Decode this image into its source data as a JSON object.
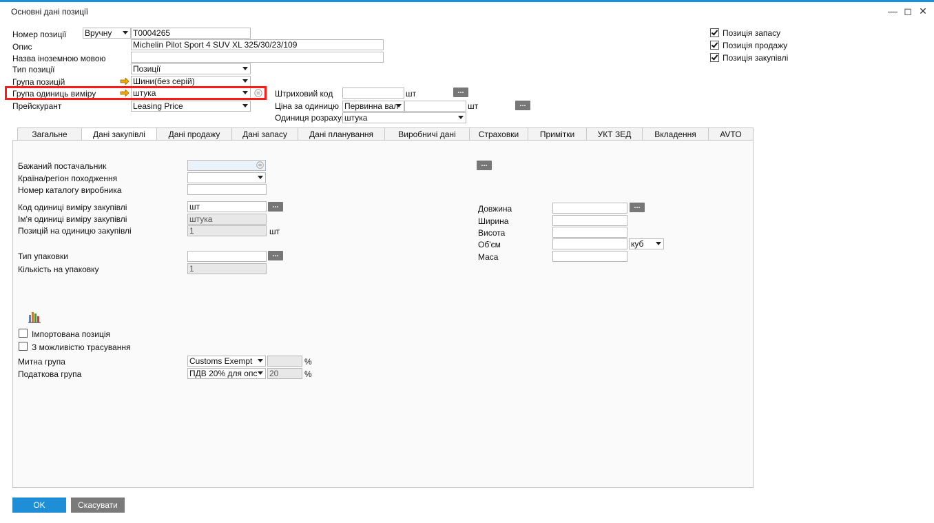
{
  "window": {
    "title": "Основні дані позиції",
    "minimize_icon": "minimize-icon",
    "maximize_icon": "maximize-icon",
    "close_icon": "close-icon"
  },
  "header": {
    "item_no_label": "Номер позиції",
    "numbering_value": "Вручну",
    "item_no_value": "T0004265",
    "description_label": "Опис",
    "description_value": "Michelin Pilot Sport 4 SUV XL 325/30/23/109",
    "foreign_name_label": "Назва іноземною мовою",
    "foreign_name_value": "",
    "item_type_label": "Тип позиції",
    "item_type_value": "Позиції",
    "item_group_label": "Група позицій",
    "item_group_value": "Шини(без серій)",
    "uom_group_label": "Група одиниць виміру",
    "uom_group_value": "штука",
    "price_list_label": "Прейскурант",
    "price_list_value": "Leasing Price",
    "barcode_label": "Штриховий код",
    "barcode_value": "",
    "barcode_unit": "шт",
    "unit_price_label": "Ціна за одиницю",
    "unit_price_currency": "Первинна вал",
    "unit_price_value": "",
    "unit_price_unit": "шт",
    "calc_unit_label": "Одиниця розрахун",
    "calc_unit_value": "штука",
    "inventory_item_label": "Позиція запасу",
    "sales_item_label": "Позиція продажу",
    "purchase_item_label": "Позиція закупівлі",
    "dots": "..."
  },
  "tabs": [
    "Загальне",
    "Дані закупівлі",
    "Дані продажу",
    "Дані запасу",
    "Дані планування",
    "Виробничі дані",
    "Страховки",
    "Примітки",
    "УКТ ЗЕД",
    "Вкладення",
    "AVTO"
  ],
  "purchasing": {
    "vendor_label": "Бажаний постачальник",
    "vendor_value": "",
    "country_label": "Країна/регіон походження",
    "country_value": "",
    "catalog_label": "Номер каталогу виробника",
    "catalog_value": "",
    "uom_code_label": "Код одиниці виміру закупівлі",
    "uom_code_value": "шт",
    "uom_name_label": "Ім'я одиниці виміру закупівлі",
    "uom_name_value": "штука",
    "items_per_unit_label": "Позицій на одиницю закупівлі",
    "items_per_unit_value": "1",
    "items_per_unit_unit": "шт",
    "pack_type_label": "Тип упаковки",
    "pack_type_value": "",
    "qty_per_pack_label": "Кількість на упаковку",
    "qty_per_pack_value": "1",
    "length_label": "Довжина",
    "width_label": "Ширина",
    "height_label": "Висота",
    "volume_label": "Об'єм",
    "volume_unit": "куб",
    "weight_label": "Маса",
    "imported_label": "Імпортована позиція",
    "traceable_label": "З можливістю трасування",
    "customs_label": "Митна група",
    "customs_value": "Customs Exempt",
    "customs_pct": "",
    "tax_label": "Податкова група",
    "tax_value": "ПДВ 20% для опс",
    "tax_pct": "20",
    "percent": "%"
  },
  "footer": {
    "ok": "OK",
    "cancel": "Скасувати"
  },
  "colors": {
    "accent": "#1e8fd6",
    "ok_button": "#1e8fd6",
    "cancel_button": "#7a7a7a",
    "highlight": "#ff1a1a",
    "arrow": "#f0a500"
  }
}
